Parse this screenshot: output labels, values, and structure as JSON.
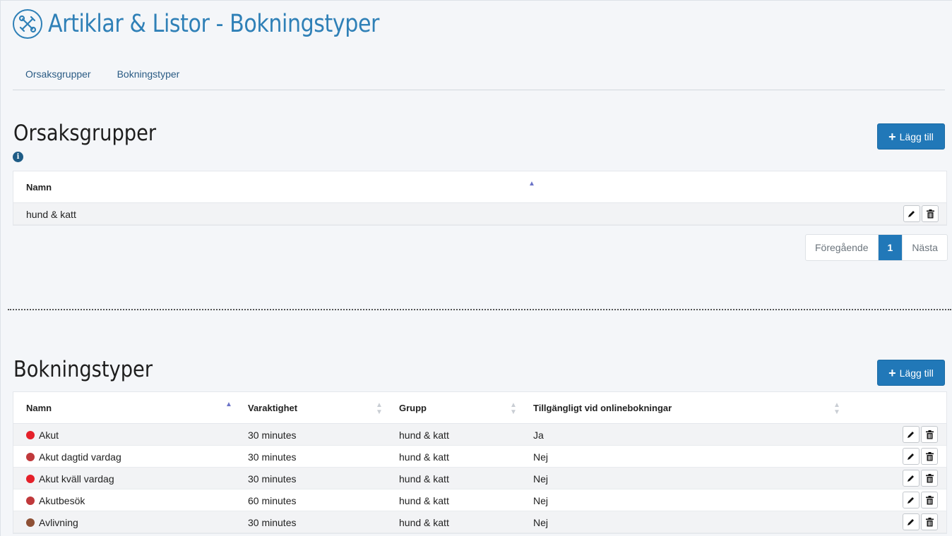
{
  "header": {
    "title": "Artiklar & Listor - Bokningstyper",
    "icon": "tools-icon"
  },
  "tabs": [
    {
      "label": "Orsaksgrupper"
    },
    {
      "label": "Bokningstyper"
    }
  ],
  "orsaksgrupper": {
    "title": "Orsaksgrupper",
    "add_label": "Lägg till",
    "columns": {
      "name": "Namn"
    },
    "rows": [
      {
        "name": "hund & katt"
      }
    ],
    "pagination": {
      "prev": "Föregående",
      "current": "1",
      "next": "Nästa"
    }
  },
  "bokningstyper": {
    "title": "Bokningstyper",
    "add_label": "Lägg till",
    "columns": {
      "name": "Namn",
      "duration": "Varaktighet",
      "group": "Grupp",
      "online": "Tillgängligt vid onlinebokningar"
    },
    "rows": [
      {
        "color": "#e5202a",
        "name": "Akut",
        "duration": "30 minutes",
        "group": "hund & katt",
        "online": "Ja"
      },
      {
        "color": "#c0393b",
        "name": "Akut dagtid vardag",
        "duration": "30 minutes",
        "group": "hund & katt",
        "online": "Nej"
      },
      {
        "color": "#e5202a",
        "name": "Akut kväll vardag",
        "duration": "30 minutes",
        "group": "hund & katt",
        "online": "Nej"
      },
      {
        "color": "#c0393b",
        "name": "Akutbesök",
        "duration": "60 minutes",
        "group": "hund & katt",
        "online": "Nej"
      },
      {
        "color": "#8e5035",
        "name": "Avlivning",
        "duration": "30 minutes",
        "group": "hund & katt",
        "online": "Nej"
      }
    ]
  },
  "colors": {
    "accent": "#2178b8",
    "title": "#2f80b7"
  }
}
